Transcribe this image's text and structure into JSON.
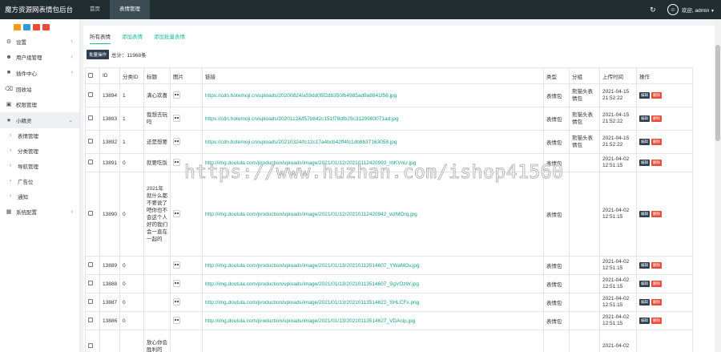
{
  "header": {
    "brand": "魔方资源网表情包后台",
    "tabs": [
      {
        "label": "首页",
        "active": false
      },
      {
        "label": "表情管理",
        "active": true
      }
    ],
    "refresh_icon": "refresh-icon",
    "user": "欢迎, admin"
  },
  "sidebar": {
    "quick_colors": [
      "#f39c12",
      "#3498db",
      "#e74c3c",
      "#e74c3c"
    ],
    "items": [
      {
        "label": "设置",
        "icon": "gear-icon",
        "has_arrow": true
      },
      {
        "label": "用户组管理",
        "icon": "users-icon",
        "has_arrow": true
      },
      {
        "label": "插件中心",
        "icon": "plugin-icon",
        "has_arrow": true
      },
      {
        "label": "回收站",
        "icon": "trash-icon",
        "has_arrow": false
      },
      {
        "label": "权限管理",
        "icon": "lock-icon",
        "has_arrow": false
      },
      {
        "label": "小精灵",
        "icon": "sprite-icon",
        "has_arrow": true,
        "active": true
      }
    ],
    "subitems": [
      {
        "label": "表情管理"
      },
      {
        "label": "分类管理"
      },
      {
        "label": "导航管理"
      },
      {
        "label": "广告位"
      },
      {
        "label": "通知"
      }
    ],
    "last_item": {
      "label": "系统配置",
      "icon": "settings-icon"
    }
  },
  "main": {
    "subtabs": [
      "所有表情",
      "添加表情",
      "添加批量表情"
    ],
    "batch_button": "批量操作",
    "total": "总计：11968条",
    "columns": [
      "",
      "ID",
      "分类ID",
      "标题",
      "图片",
      "链接",
      "类型",
      "分组",
      "上传时间",
      "操作"
    ],
    "edit_label": "编辑",
    "delete_label": "删除",
    "rows": [
      {
        "id": "13894",
        "cat": "1",
        "title": "满心欢喜",
        "link": "https://cdn.hotemoji.cn/uploads/20200824/a59dd05f2db350fb4985ad9a8841f56.jpg",
        "type": "表情包",
        "group": "熊猫头表情包",
        "time": "2021-04-15 21:52:22"
      },
      {
        "id": "13893",
        "cat": "1",
        "title": "我想去玩吗",
        "link": "https://cdn.hotemoji.cn/uploads/20201124/f57b842c151f78dfb29c3129980071ad.jpg",
        "type": "表情包",
        "group": "熊猫头表情包",
        "time": "2021-04-15 21:52:22"
      },
      {
        "id": "13892",
        "cat": "1",
        "title": "还是想要",
        "link": "https://cdn.hotemoji.cn/uploads/20210324/fc12c17a4bcb42ff4fc1db8b37163058.jpg",
        "type": "表情包",
        "group": "熊猫头表情包",
        "time": "2021-04-15 21:52:22"
      },
      {
        "id": "13891",
        "cat": "0",
        "title": "就要吃饭",
        "link": "http://img.doutula.com/production/uploads/image/2021/01/12/20210112420993_rbKVnU.jpg",
        "type": "表情包",
        "group": "",
        "time": "2021-04-02 12:51:15"
      },
      {
        "id": "13890",
        "cat": "0",
        "title": "2021年就什么都不要说了吧你也不会这个人好的我们会一直在一起的",
        "link": "http://img.doutula.com/production/uploads/image/2021/01/12/20210112420942_wzMOrq.jpg",
        "type": "表情包",
        "group": "",
        "time": "2021-04-02 12:51:15"
      },
      {
        "id": "13889",
        "cat": "0",
        "title": "",
        "link": "http://img.doutula.com/production/uploads/image/2021/01/13/20210113514607_YWaMOv.jpg",
        "type": "表情包",
        "group": "",
        "time": "2021-04-02 12:51:15"
      },
      {
        "id": "13888",
        "cat": "0",
        "title": "",
        "link": "http://img.doutula.com/production/uploads/image/2021/01/13/20210113514607_SgVOzW.jpg",
        "type": "表情包",
        "group": "",
        "time": "2021-04-02 12:51:15"
      },
      {
        "id": "13887",
        "cat": "0",
        "title": "",
        "link": "http://img.doutula.com/production/uploads/image/2021/01/13/20210113514622_SHLCFx.png",
        "type": "表情包",
        "group": "",
        "time": "2021-04-02 12:51:15"
      },
      {
        "id": "13886",
        "cat": "0",
        "title": "",
        "link": "http://img.doutula.com/production/uploads/image/2021/01/13/20210113514627_VDAcip.jpg",
        "type": "表情包",
        "group": "",
        "time": "2021-04-02 12:51:15"
      },
      {
        "id": "",
        "cat": "",
        "title": "放心你会胜利的",
        "link": "",
        "type": "",
        "group": "",
        "time": "2021-04-02"
      }
    ]
  },
  "watermark": "https://www.huzhan.com/ishop41560"
}
